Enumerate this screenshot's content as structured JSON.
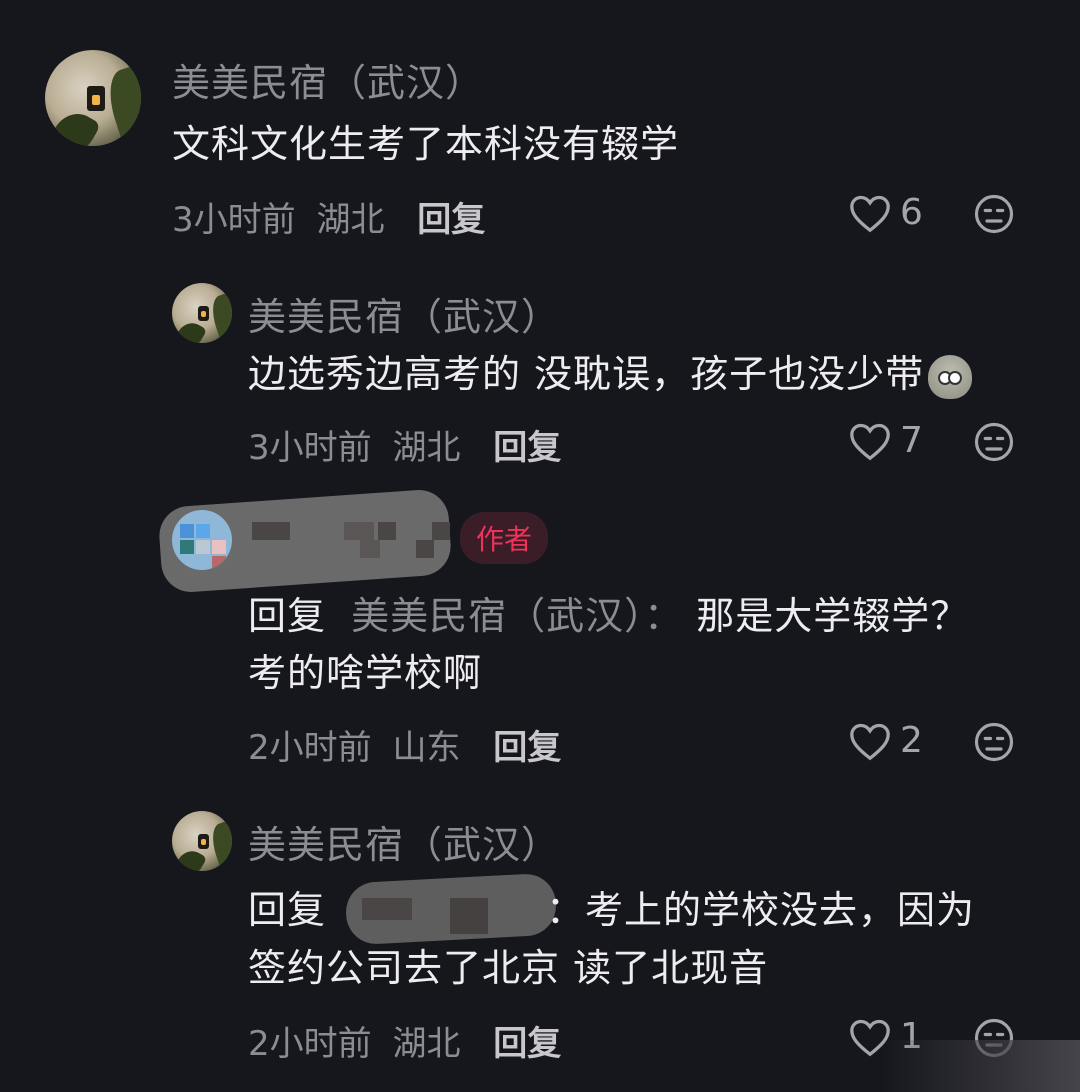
{
  "comments": [
    {
      "username": "美美民宿（武汉）",
      "text": "文科文化生考了本科没有辍学",
      "time": "3小时前",
      "location": "湖北",
      "reply_label": "回复",
      "likes": "6"
    },
    {
      "username": "美美民宿（武汉）",
      "text": "边选秀边高考的 没耽误，孩子也没少带",
      "emoji": "blob-shocked-emoji",
      "time": "3小时前",
      "location": "湖北",
      "reply_label": "回复",
      "likes": "7"
    },
    {
      "badge": "作者",
      "reply_prefix": "回复",
      "reply_target": "美美民宿（武汉）：",
      "text_line1": "那是大学辍学？",
      "text_line2": "考的啥学校啊",
      "time": "2小时前",
      "location": "山东",
      "reply_label": "回复",
      "likes": "2"
    },
    {
      "username": "美美民宿（武汉）",
      "reply_prefix": "回复",
      "text_line1": "：考上的学校没去，因为",
      "text_line2": "签约公司去了北京 读了北现音",
      "time": "2小时前",
      "location": "湖北",
      "reply_label": "回复",
      "likes": "1"
    }
  ],
  "colors": {
    "background": "#16161d",
    "primary_text": "#ededf0",
    "secondary_text": "#8c8c93",
    "author_badge": "#f0325a"
  }
}
